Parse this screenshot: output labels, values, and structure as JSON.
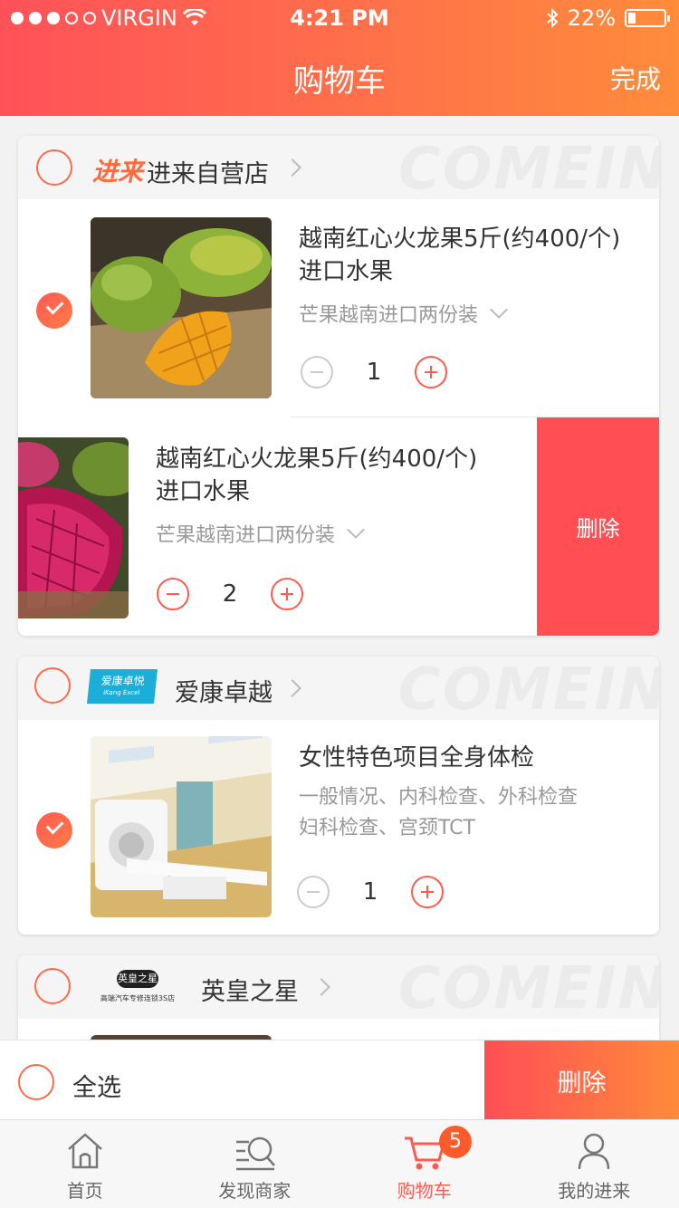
{
  "status_bar": {
    "carrier": "VIRGIN",
    "time": "4:21 PM",
    "battery": "22%"
  },
  "header": {
    "title": "购物车",
    "done_label": "完成"
  },
  "stores": [
    {
      "name": "进来自营店",
      "logo_text": "进来",
      "watermark": "COMEIN",
      "items": [
        {
          "title_line1": "越南红心火龙果5斤(约400/个)",
          "title_line2": "进口水果",
          "spec": "芒果越南进口两份装",
          "quantity": "1",
          "image": "mango-photo",
          "checked": true
        },
        {
          "title_line1": "越南红心火龙果5斤(约400/个)",
          "title_line2": "进口水果",
          "spec": "芒果越南进口两份装",
          "quantity": "2",
          "image": "dragonfruit-photo",
          "checked": false,
          "swipe_delete_label": "删除"
        }
      ]
    },
    {
      "name": "爱康卓越",
      "logo_text": "爱康卓悦",
      "logo_subtext": "iKang Excel",
      "watermark": "COMEIN",
      "items": [
        {
          "title": "女性特色项目全身体检",
          "desc_line1": "一般情况、内科检查、外科检查",
          "desc_line2": "妇科检查、宫颈TCT",
          "quantity": "1",
          "image": "ct-scanner-photo",
          "checked": true
        }
      ]
    },
    {
      "name": "英皇之星",
      "logo_text": "英皇之星",
      "logo_subtext": "高端汽车专修连锁3S店",
      "watermark": "COMEIN"
    }
  ],
  "bottom_bar": {
    "select_all_label": "全选",
    "delete_label": "删除"
  },
  "tabbar": {
    "items": [
      {
        "label": "首页",
        "icon": "home-icon"
      },
      {
        "label": "发现商家",
        "icon": "discover-icon"
      },
      {
        "label": "购物车",
        "icon": "cart-icon",
        "badge": "5",
        "active": true
      },
      {
        "label": "我的进来",
        "icon": "profile-icon"
      }
    ]
  },
  "colors": {
    "accent": "#ff5a4d",
    "gradient_end": "#ff8c3a",
    "delete_red": "#ff4f55"
  }
}
